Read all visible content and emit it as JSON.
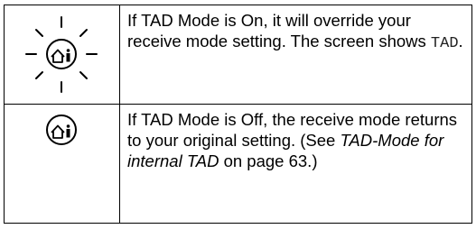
{
  "rows": [
    {
      "icon": "tad-button-lit-icon",
      "text_before": "If TAD Mode is On, it will override your receive mode setting. The screen shows ",
      "code": "TAD",
      "text_after": "."
    },
    {
      "icon": "tad-button-off-icon",
      "text_before": "If TAD Mode is Off, the receive mode returns to your original setting. (See ",
      "ref_title": "TAD-Mode for internal TAD",
      "text_after": " on page 63.)"
    }
  ]
}
